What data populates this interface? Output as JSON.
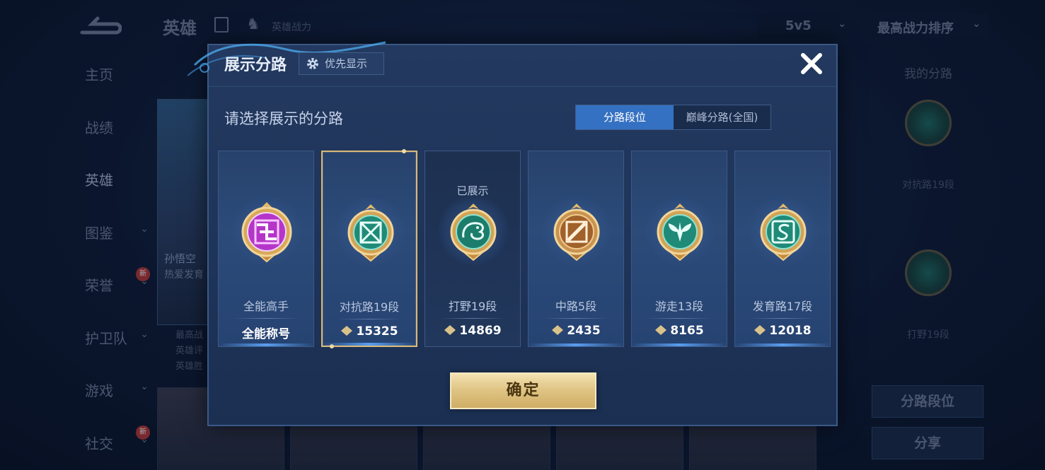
{
  "background": {
    "page_title": "英雄",
    "power_label": "英雄战力",
    "mode_select": "5v5",
    "sort_select": "最高战力排序",
    "nav": [
      {
        "label": "主页"
      },
      {
        "label": "战绩"
      },
      {
        "label": "英雄"
      },
      {
        "label": "图鉴"
      },
      {
        "label": "荣誉",
        "badge": "新"
      },
      {
        "label": "护卫队"
      },
      {
        "label": "游戏"
      },
      {
        "label": "社交",
        "badge": "新"
      }
    ],
    "hero_name": "孙悟空",
    "hero_subtitle": "热爱发育",
    "hero_info": [
      "最高战",
      "英雄评",
      "英雄胜"
    ],
    "right_panel": {
      "title": "我的分路",
      "lane1": "对抗路19段",
      "lane2": "打野19段",
      "btn_lane_rank": "分路段位",
      "btn_share": "分享"
    }
  },
  "dialog": {
    "title": "展示分路",
    "priority_button": "优先显示",
    "subtitle": "请选择展示的分路",
    "tabs": [
      {
        "label": "分路段位",
        "active": true
      },
      {
        "label": "巅峰分路(全国)",
        "active": false
      }
    ],
    "cards": [
      {
        "name": "全能高手",
        "value": "全能称号",
        "has_icon": false,
        "status": "",
        "emblem": "allround-emblem-icon"
      },
      {
        "name": "对抗路19段",
        "value": "15325",
        "has_icon": true,
        "status": "",
        "emblem": "clash-lane-emblem-icon",
        "selected": true
      },
      {
        "name": "打野19段",
        "value": "14869",
        "has_icon": true,
        "status": "已展示",
        "emblem": "jungle-emblem-icon"
      },
      {
        "name": "中路5段",
        "value": "2435",
        "has_icon": true,
        "status": "",
        "emblem": "mid-lane-emblem-icon"
      },
      {
        "name": "游走13段",
        "value": "8165",
        "has_icon": true,
        "status": "",
        "emblem": "roam-emblem-icon"
      },
      {
        "name": "发育路17段",
        "value": "12018",
        "has_icon": true,
        "status": "",
        "emblem": "farm-lane-emblem-icon"
      }
    ],
    "confirm_button": "确定"
  },
  "colors": {
    "accent_blue": "#3571c2",
    "gold": "#d8b979",
    "teal_emblem": "#1f8a78",
    "purple_emblem": "#b535c9",
    "bronze_emblem": "#a0612a"
  }
}
